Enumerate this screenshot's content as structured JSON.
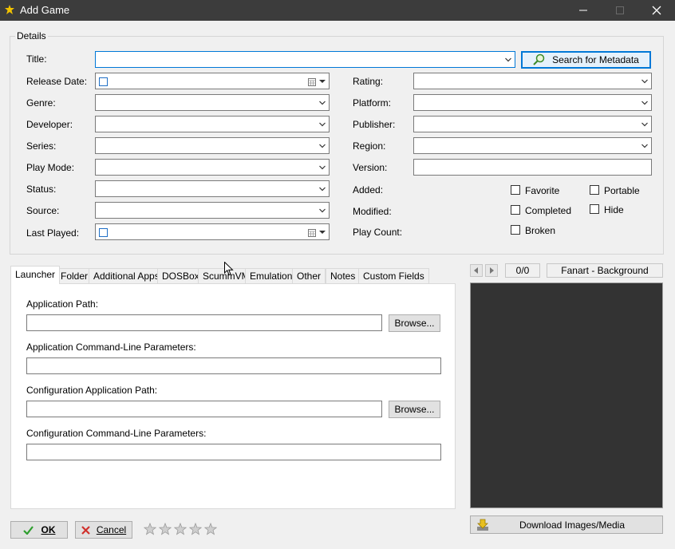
{
  "window": {
    "title": "Add Game",
    "minimize_icon": "minimize-icon",
    "maximize_icon": "maximize-icon",
    "close_icon": "close-icon"
  },
  "details": {
    "group_label": "Details",
    "title_label": "Title:",
    "title_value": "",
    "search_metadata_label": "Search for Metadata",
    "left_fields": [
      {
        "label": "Release Date:",
        "value": ""
      },
      {
        "label": "Genre:",
        "value": ""
      },
      {
        "label": "Developer:",
        "value": ""
      },
      {
        "label": "Series:",
        "value": ""
      },
      {
        "label": "Play Mode:",
        "value": ""
      },
      {
        "label": "Status:",
        "value": ""
      },
      {
        "label": "Source:",
        "value": ""
      },
      {
        "label": "Last Played:",
        "value": ""
      }
    ],
    "right_fields": [
      {
        "label": "Rating:",
        "value": ""
      },
      {
        "label": "Platform:",
        "value": ""
      },
      {
        "label": "Publisher:",
        "value": ""
      },
      {
        "label": "Region:",
        "value": ""
      },
      {
        "label": "Version:",
        "value": ""
      },
      {
        "label": "Added:",
        "value": ""
      },
      {
        "label": "Modified:",
        "value": ""
      },
      {
        "label": "Play Count:",
        "value": ""
      }
    ],
    "checkboxes": {
      "favorite": {
        "label": "Favorite",
        "checked": false
      },
      "completed": {
        "label": "Completed",
        "checked": false
      },
      "broken": {
        "label": "Broken",
        "checked": false
      },
      "portable": {
        "label": "Portable",
        "checked": false
      },
      "hide": {
        "label": "Hide",
        "checked": false
      }
    }
  },
  "tabs": [
    {
      "label": "Launcher",
      "active": true
    },
    {
      "label": "Folder"
    },
    {
      "label": "Additional Apps"
    },
    {
      "label": "DOSBox"
    },
    {
      "label": "ScummVM"
    },
    {
      "label": "Emulation"
    },
    {
      "label": "Other"
    },
    {
      "label": "Notes"
    },
    {
      "label": "Custom Fields"
    }
  ],
  "launcher": {
    "app_path_label": "Application Path:",
    "app_path_value": "",
    "browse_label": "Browse...",
    "app_params_label": "Application Command-Line Parameters:",
    "app_params_value": "",
    "config_path_label": "Configuration Application Path:",
    "config_path_value": "",
    "config_browse_label": "Browse...",
    "config_params_label": "Configuration Command-Line Parameters:",
    "config_params_value": ""
  },
  "media": {
    "counter": "0/0",
    "image_type": "Fanart - Background",
    "download_label": "Download Images/Media"
  },
  "footer": {
    "ok_label": "OK",
    "cancel_label": "Cancel",
    "stars": 0,
    "stars_max": 5
  },
  "colors": {
    "titlebar": "#3c3c3c",
    "accent": "#0078d7",
    "image_background": "#333333"
  }
}
